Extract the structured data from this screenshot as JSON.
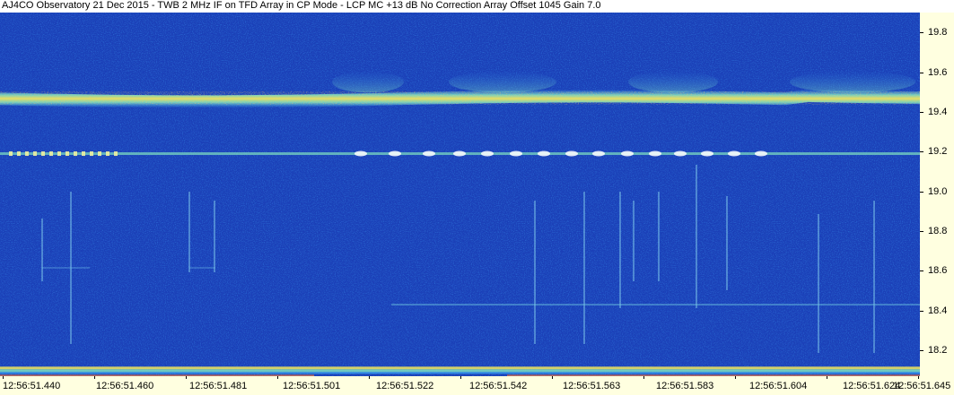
{
  "chart_data": {
    "type": "heatmap",
    "title": "AJ4CO Observatory 21 Dec 2015 - TWB 2 MHz IF on TFD Array in CP Mode - LCP  MC +13 dB  No Correction Array  Offset 1045  Gain 7.0",
    "x_tick_labels": [
      "12:56:51.440",
      "12:56:51.460",
      "12:56:51.481",
      "12:56:51.501",
      "12:56:51.522",
      "12:56:51.542",
      "12:56:51.563",
      "12:56:51.583",
      "12:56:51.604",
      "12:56:51.624",
      "12:56:51.645"
    ],
    "y_tick_labels": [
      "19.8",
      "19.6",
      "19.4",
      "19.2",
      "19.0",
      "18.8",
      "18.6",
      "18.4",
      "18.2"
    ],
    "y_ticks": [
      19.8,
      19.6,
      19.4,
      19.2,
      19.0,
      18.8,
      18.6,
      18.4,
      18.2
    ],
    "ylim": [
      18.07,
      19.9
    ],
    "xlim_seconds": [
      51.44,
      51.645
    ],
    "y_axis_side": "right",
    "colormap": [
      "#0a1a80",
      "#1e4fd6",
      "#3aa0f0",
      "#7fe0c0",
      "#e8e060",
      "#f07a40"
    ],
    "background_color": "#1a3fb8",
    "features": [
      {
        "name": "emission band",
        "y": 19.47
      },
      {
        "name": "pulse train",
        "y": 19.19
      },
      {
        "name": "faint line",
        "y": 18.43
      },
      {
        "name": "bottom band",
        "y": 18.1
      }
    ]
  }
}
